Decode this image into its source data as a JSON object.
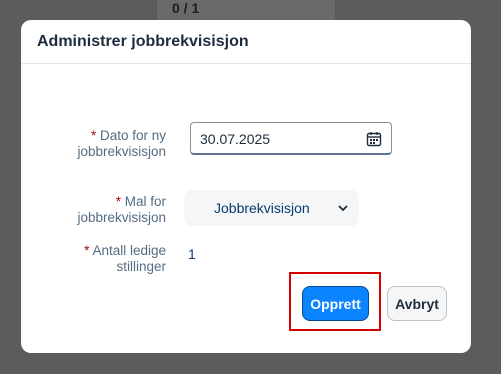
{
  "background": {
    "counter": "0 / 1"
  },
  "dialog": {
    "title": "Administrer jobbrekvisisjon",
    "fields": {
      "date": {
        "required": "*",
        "label_line1": "Dato for ny",
        "label_line2": "jobbrekvisisjon",
        "value": "30.07.2025",
        "icon": "calendar-icon"
      },
      "template": {
        "required": "*",
        "label_line1": "Mal for",
        "label_line2": "jobbrekvisisjon",
        "value": "Jobbrekvisisjon",
        "icon": "chevron-down-icon"
      },
      "openings": {
        "required": "*",
        "label_line1": "Antall ledige",
        "label_line2": "stillinger",
        "value": "1"
      }
    },
    "buttons": {
      "create": "Opprett",
      "cancel": "Avbryt"
    }
  },
  "colors": {
    "primary": "#0a84ff",
    "required": "#aa0808",
    "highlight": "#d50000"
  }
}
